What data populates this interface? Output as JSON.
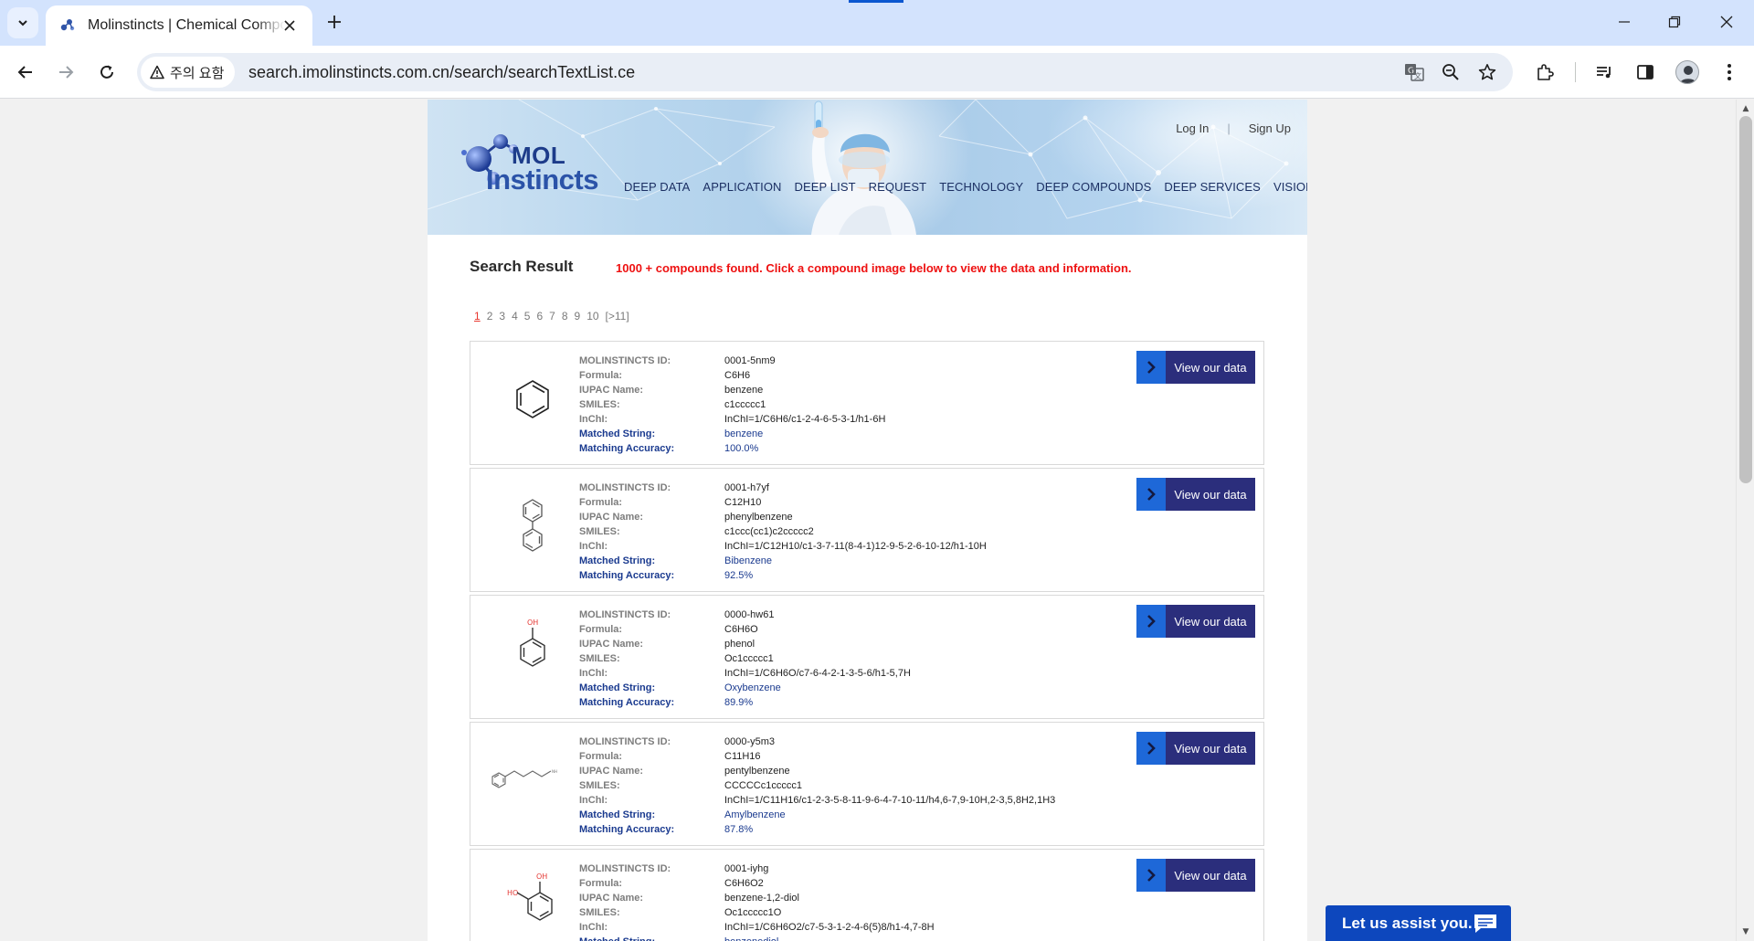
{
  "browser": {
    "tab_title": "Molinstincts | Chemical Compound Search",
    "security_label": "주의 요함",
    "url": "search.imolinstincts.com.cn/search/searchTextList.ce"
  },
  "header": {
    "logo_word1": "MOL",
    "logo_word2": "Instincts",
    "login": "Log In",
    "separator": "|",
    "signup": "Sign Up",
    "nav": [
      "DEEP DATA",
      "APPLICATION",
      "DEEP LIST",
      "REQUEST",
      "TECHNOLOGY",
      "DEEP COMPOUNDS",
      "DEEP SERVICES",
      "VISION"
    ]
  },
  "search": {
    "title": "Search Result",
    "message": "1000 + compounds found. Click a compound image below to view the data and information.",
    "pages": [
      "1",
      "2",
      "3",
      "4",
      "5",
      "6",
      "7",
      "8",
      "9",
      "10",
      "[>11]"
    ],
    "current_page": "1"
  },
  "labels": {
    "id": "MOLINSTINCTS ID:",
    "formula": "Formula:",
    "iupac": "IUPAC Name:",
    "smiles": "SMILES:",
    "inchi": "InChI:",
    "matched": "Matched String:",
    "accuracy": "Matching Accuracy:"
  },
  "view_button_label": "View our data",
  "results": [
    {
      "id": "0001-5nm9",
      "formula": "C6H6",
      "iupac": "benzene",
      "smiles": "c1ccccc1",
      "inchi": "InChI=1/C6H6/c1-2-4-6-5-3-1/h1-6H",
      "matched": "benzene",
      "accuracy": "100.0%",
      "structure": "benzene"
    },
    {
      "id": "0001-h7yf",
      "formula": "C12H10",
      "iupac": "phenylbenzene",
      "smiles": "c1ccc(cc1)c2ccccc2",
      "inchi": "InChI=1/C12H10/c1-3-7-11(8-4-1)12-9-5-2-6-10-12/h1-10H",
      "matched": "Bibenzene",
      "accuracy": "92.5%",
      "structure": "biphenyl"
    },
    {
      "id": "0000-hw61",
      "formula": "C6H6O",
      "iupac": "phenol",
      "smiles": "Oc1ccccc1",
      "inchi": "InChI=1/C6H6O/c7-6-4-2-1-3-5-6/h1-5,7H",
      "matched": "Oxybenzene",
      "accuracy": "89.9%",
      "structure": "phenol",
      "atom_label": "OH"
    },
    {
      "id": "0000-y5m3",
      "formula": "C11H16",
      "iupac": "pentylbenzene",
      "smiles": "CCCCCc1ccccc1",
      "inchi": "InChI=1/C11H16/c1-2-3-5-8-11-9-6-4-7-10-11/h4,6-7,9-10H,2-3,5,8H2,1H3",
      "matched": "Amylbenzene",
      "accuracy": "87.8%",
      "structure": "pentylbenzene"
    },
    {
      "id": "0001-iyhg",
      "formula": "C6H6O2",
      "iupac": "benzene-1,2-diol",
      "smiles": "Oc1ccccc1O",
      "inchi": "InChI=1/C6H6O2/c7-5-3-1-2-4-6(5)8/h1-4,7-8H",
      "matched": "benzenediol",
      "accuracy": "",
      "structure": "catechol",
      "atom_label": "OH",
      "atom_label2": "HO"
    }
  ],
  "assist": {
    "label": "Let us assist you."
  },
  "colors": {
    "accent_red": "#ee1111",
    "button_dark": "#2b2e7c",
    "button_arrow": "#1e68d8",
    "matched_blue": "#1a3a8f",
    "assist_blue": "#0d47bd"
  }
}
